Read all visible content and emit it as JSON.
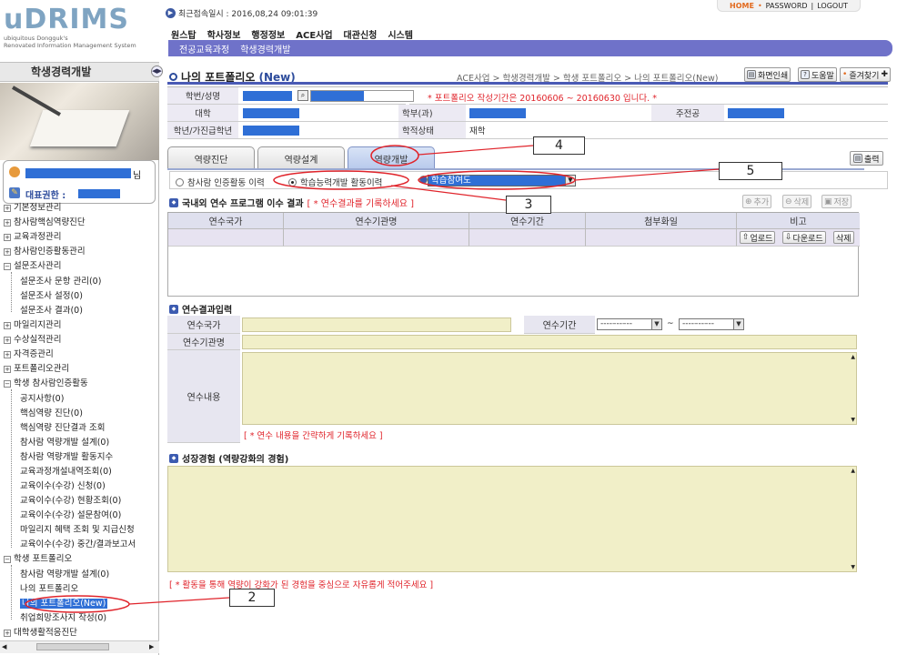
{
  "header": {
    "logo_text": "uDRIMS",
    "logo_sub1": "ubiquitous Dongguk's",
    "logo_sub2": "Renovated Information Management System",
    "last_login": "최근접속일시 : 2016,08,24 09:01:39",
    "top_links": {
      "home": "HOME",
      "password": "PASSWORD",
      "logout": "LOGOUT"
    },
    "menu": [
      "원스탑",
      "학사정보",
      "행정정보",
      "ACE사업",
      "대관신청",
      "시스템"
    ],
    "submenu": [
      "전공교육과정",
      "학생경력개발"
    ]
  },
  "sidebar": {
    "title": "학생경력개발",
    "user_suffix": "님",
    "role_label": "대표권한 :",
    "tree": [
      {
        "label": "기본정보관리",
        "sign": "+"
      },
      {
        "label": "참사람핵심역량진단",
        "sign": "+"
      },
      {
        "label": "교육과정관리",
        "sign": "+"
      },
      {
        "label": "참사람인증활동관리",
        "sign": "+"
      },
      {
        "label": "설문조사관리",
        "sign": "-"
      },
      {
        "label": "마일리지관리",
        "sign": "+"
      },
      {
        "label": "수상실적관리",
        "sign": "+"
      },
      {
        "label": "자격증관리",
        "sign": "+"
      },
      {
        "label": "포트폴리오관리",
        "sign": "+"
      },
      {
        "label": "학생 참사람인증활동",
        "sign": "-"
      },
      {
        "label": "학생 포트폴리오",
        "sign": "-"
      },
      {
        "label": "대학생활적응진단",
        "sign": "+"
      }
    ],
    "survey_children": [
      "설문조사 문항 관리(0)",
      "설문조사 설정(0)",
      "설문조사 결과(0)"
    ],
    "activity_children": [
      "공지사항(0)",
      "핵심역량 진단(0)",
      "핵심역량 진단결과 조회",
      "참사람 역량개발 설계(0)",
      "참사람 역량개발 활동지수",
      "교육과정개설내역조회(0)",
      "교육이수(수강) 신청(0)",
      "교육이수(수강) 현황조회(0)",
      "교육이수(수강) 설문참여(0)",
      "마일리지 혜택 조회 및 지급신청",
      "교육이수(수강) 중간/결과보고서"
    ],
    "portfolio_children": [
      "참사람 역량개발 설계(0)",
      "나의 포트폴리오",
      "나의 포트폴리오(New)",
      "취업희망조사지 작성(0)"
    ]
  },
  "main": {
    "title": "나의 포트폴리오",
    "title_new": "(New)",
    "breadcrumb": "ACE사업 > 학생경력개발 > 학생 포트폴리오 > 나의 포트폴리오(New)",
    "buttons": {
      "print_screen": "화면인쇄",
      "help": "도움말",
      "favorites": "즐겨찾기",
      "print": "출력"
    },
    "info": {
      "student_label": "학번/성명",
      "notice": "* 포트폴리오  작성기간은 20160606 ~ 20160630 입니다. *",
      "college_label": "대학",
      "dept_label": "학부(과)",
      "major_label": "주전공",
      "year_label": "학년/가진급학년",
      "status_label": "학적상태",
      "status_value": "재학"
    },
    "tabs": [
      "역량진단",
      "역량설계",
      "역량개발"
    ],
    "radios": [
      "참사람 인증활동 이력",
      "학습능력개발 활동이력"
    ],
    "select_value": "학습참여도",
    "section1": {
      "title": "국내외 연수 프로그램 이수 결과",
      "hint": "[ * 연수결과를 기록하세요 ]",
      "buttons": [
        "추가",
        "삭제",
        "저장"
      ],
      "columns": [
        "연수국가",
        "연수기관명",
        "연수기간",
        "첨부화일",
        "비고"
      ],
      "row_buttons": [
        "업로드",
        "다운로드",
        "삭제"
      ]
    },
    "section2": {
      "title": "연수결과입력",
      "country_label": "연수국가",
      "period_label": "연수기간",
      "date_placeholder": "----–--–--",
      "org_label": "연수기관명",
      "content_label": "연수내용",
      "hint": "[ * 연수 내용을 간략하게 기록하세요 ]"
    },
    "section3": {
      "title": "성장경험 (역량강화의 경험)",
      "hint": "[ * 활동을 통해 역량이 강화가 된 경험을 중심으로 자유롭게 적어주세요 ]"
    }
  },
  "annotations": [
    "2",
    "3",
    "4",
    "5"
  ],
  "colors": {
    "accent": "#4a5ab5",
    "redaction": "#2f6fd6",
    "callout_red": "#e0242b",
    "input_fill": "#f1efc8"
  }
}
